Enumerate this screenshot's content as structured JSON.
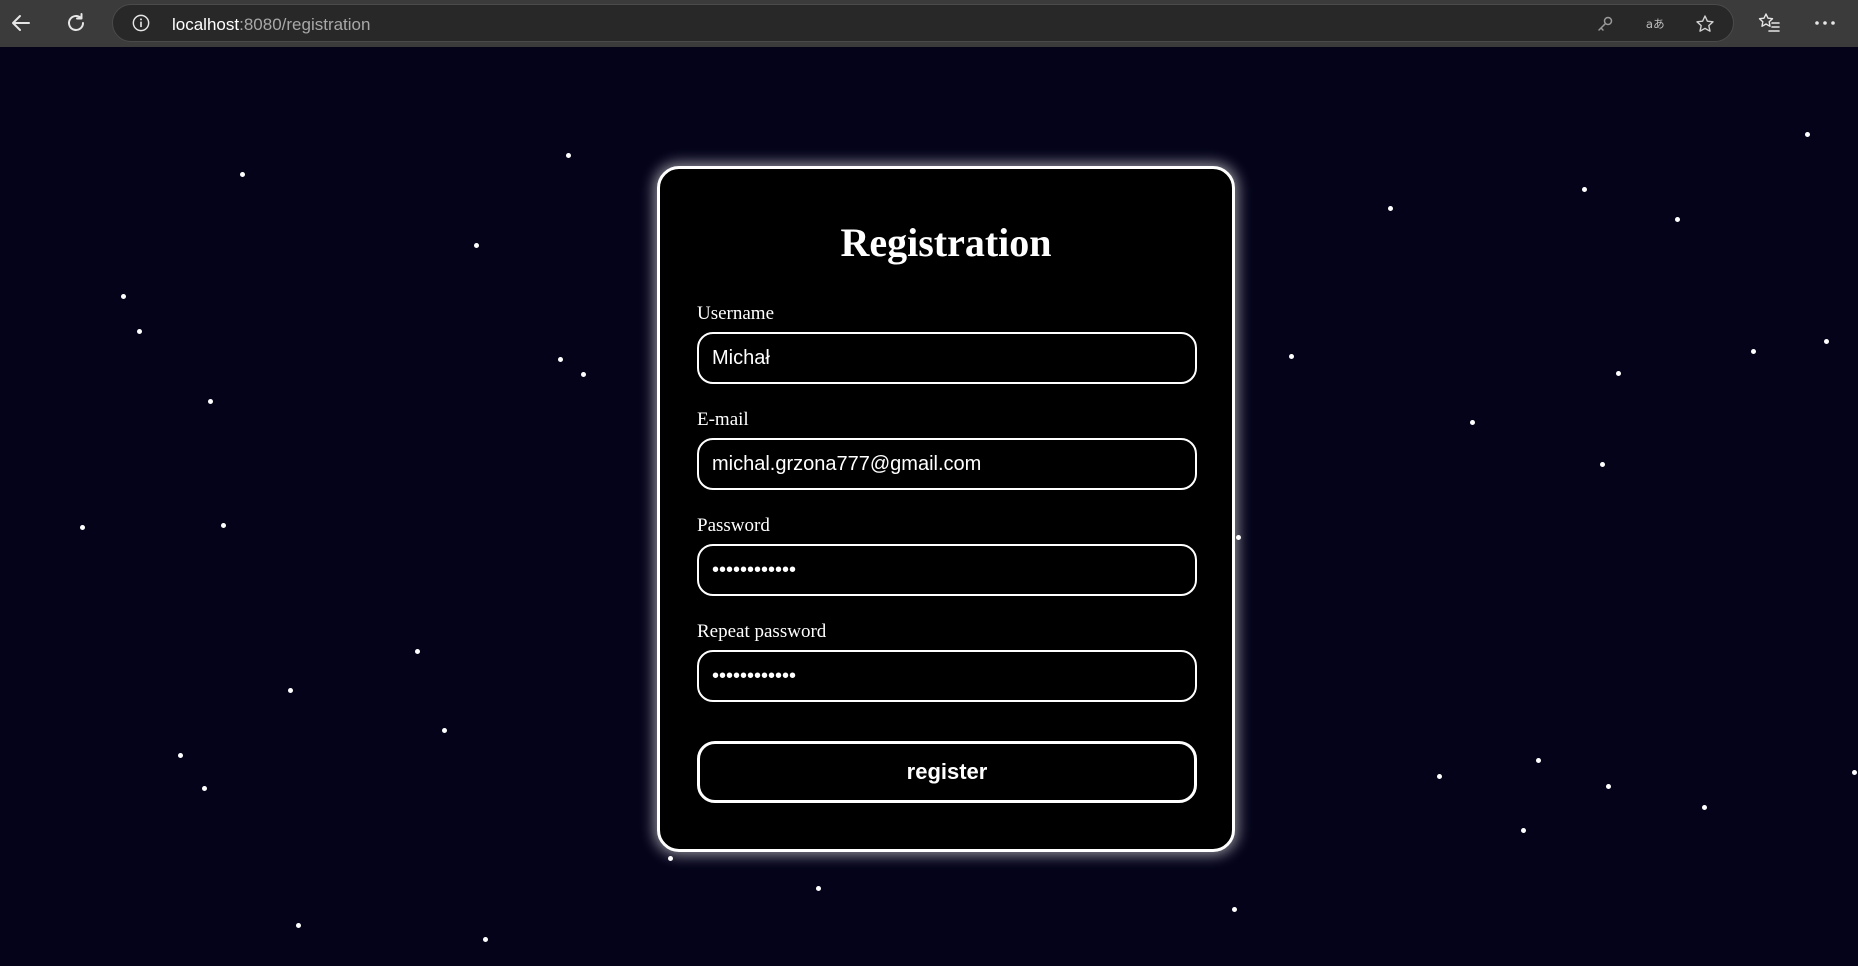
{
  "browser": {
    "url_host": "localhost",
    "url_path": ":8080/registration",
    "icons": [
      "back-arrow-icon",
      "reload-icon",
      "info-icon",
      "key-icon",
      "read-aloud-icon",
      "star-icon",
      "favorites-icon",
      "more-icon"
    ]
  },
  "form": {
    "title": "Registration",
    "fields": [
      {
        "label": "Username",
        "value": "Michał",
        "type": "text"
      },
      {
        "label": "E-mail",
        "value": "michal.grzona777@gmail.com",
        "type": "email"
      },
      {
        "label": "Password",
        "value": "••••••••••••",
        "type": "password"
      },
      {
        "label": "Repeat password",
        "value": "••••••••••••",
        "type": "password"
      }
    ],
    "submit_label": "register"
  },
  "colors": {
    "background": "#04031a",
    "card": "#000000",
    "accent": "#ffffff",
    "browser_bar": "#3b3b3b"
  }
}
